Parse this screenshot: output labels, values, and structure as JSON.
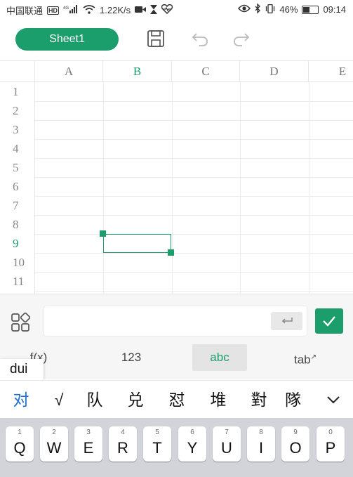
{
  "status_bar": {
    "carrier": "中国联通",
    "hd": "HD",
    "network": "4G",
    "speed": "1.22K/s",
    "battery": "46%",
    "time": "09:14"
  },
  "toolbar": {
    "sheet_label": "Sheet1",
    "icons": [
      "save-icon",
      "undo-icon",
      "redo-icon"
    ]
  },
  "grid": {
    "columns": [
      "A",
      "B",
      "C",
      "D",
      "E"
    ],
    "rows": [
      "1",
      "2",
      "3",
      "4",
      "5",
      "6",
      "7",
      "8",
      "9",
      "10",
      "11"
    ],
    "active_column": "B",
    "active_row": "9",
    "selected_cell": "B9"
  },
  "input_bar": {
    "value": "",
    "enter_icon": "return-icon",
    "confirm_icon": "check-icon"
  },
  "input_modes": {
    "items": [
      "f(x)",
      "123",
      "abc",
      "tab"
    ],
    "active": "abc"
  },
  "ime": {
    "pinyin": "dui",
    "candidates": [
      "对",
      "√",
      "队",
      "兑",
      "怼",
      "堆",
      "對",
      "隊"
    ]
  },
  "keyboard": {
    "row1": [
      {
        "num": "1",
        "letter": "Q"
      },
      {
        "num": "2",
        "letter": "W"
      },
      {
        "num": "3",
        "letter": "E"
      },
      {
        "num": "4",
        "letter": "R"
      },
      {
        "num": "5",
        "letter": "T"
      },
      {
        "num": "6",
        "letter": "Y"
      },
      {
        "num": "7",
        "letter": "U"
      },
      {
        "num": "8",
        "letter": "I"
      },
      {
        "num": "9",
        "letter": "O"
      },
      {
        "num": "0",
        "letter": "P"
      }
    ]
  },
  "colors": {
    "accent": "#1c9d6c",
    "candidate_highlight": "#1a6fd0"
  }
}
